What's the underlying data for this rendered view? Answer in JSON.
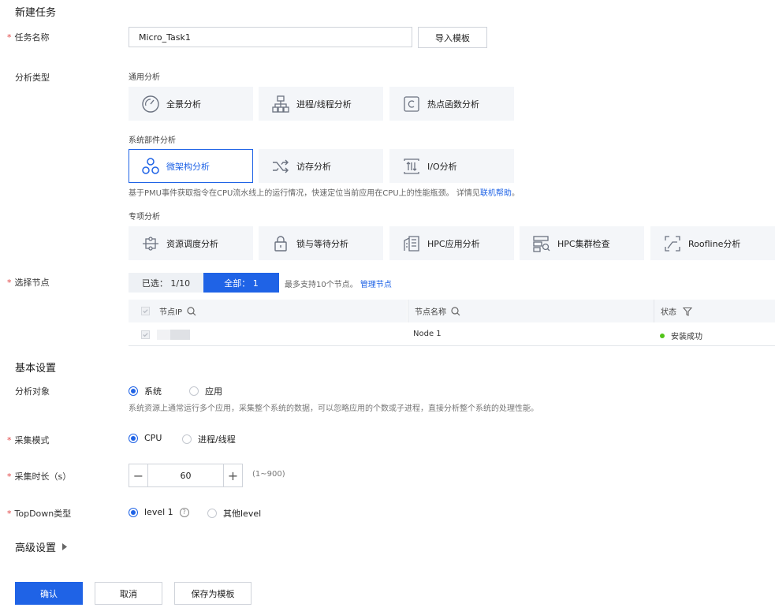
{
  "header": {
    "title": "新建任务"
  },
  "task_name": {
    "label": "任务名称",
    "value": "Micro_Task1",
    "import_button": "导入模板"
  },
  "analysis_type": {
    "label": "分析类型",
    "general": {
      "title": "通用分析",
      "items": [
        "全景分析",
        "进程/线程分析",
        "热点函数分析"
      ]
    },
    "system": {
      "title": "系统部件分析",
      "items": [
        "微架构分析",
        "访存分析",
        "I/O分析"
      ],
      "selected": "微架构分析"
    },
    "description": {
      "text": "基于PMU事件获取指令在CPU流水线上的运行情况，快速定位当前应用在CPU上的性能瓶颈。 详情见",
      "link": "联机帮助",
      "end": "。"
    },
    "special": {
      "title": "专项分析",
      "items": [
        "资源调度分析",
        "锁与等待分析",
        "HPC应用分析",
        "HPC集群检查",
        "Roofline分析"
      ]
    }
  },
  "node_select": {
    "label": "选择节点",
    "selected_tab": "已选： 1/10",
    "all_tab": "全部： 1",
    "hint": "最多支持10个节点。",
    "manage_link": "管理节点",
    "columns": [
      "节点IP",
      "节点名称",
      "状态"
    ],
    "rows": [
      {
        "ip": "",
        "name": "Node 1",
        "status": "安装成功"
      }
    ],
    "status_color": "#52c41a"
  },
  "basic": {
    "title": "基本设置",
    "target": {
      "label": "分析对象",
      "options": [
        "系统",
        "应用"
      ],
      "selected": "系统",
      "hint": "系统资源上通常运行多个应用，采集整个系统的数据，可以忽略应用的个数或子进程，直接分析整个系统的处理性能。"
    },
    "mode": {
      "label": "采集模式",
      "options": [
        "CPU",
        "进程/线程"
      ],
      "selected": "CPU"
    },
    "duration": {
      "label": "采集时长（s）",
      "value": "60",
      "range": "(1~900)"
    },
    "topdown": {
      "label": "TopDown类型",
      "options": [
        "level 1",
        "其他level"
      ],
      "selected": "level 1"
    }
  },
  "advanced": {
    "label": "高级设置"
  },
  "footer": {
    "confirm": "确认",
    "cancel": "取消",
    "save_template": "保存为模板"
  },
  "colors": {
    "accent": "#1f63e6",
    "required": "#e04444"
  }
}
